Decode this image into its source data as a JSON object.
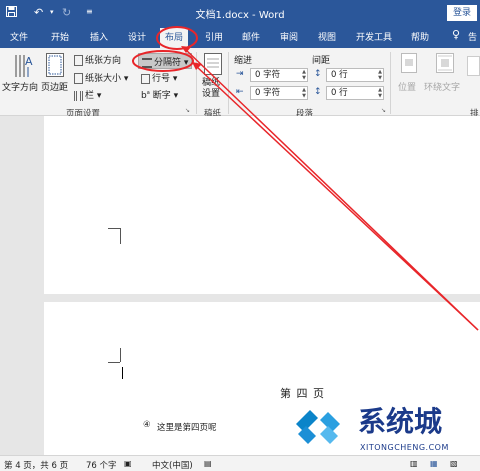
{
  "titlebar": {
    "save_icon": "save-icon",
    "undo_icon": "undo-icon",
    "redo_icon": "redo-icon",
    "qat_more_icon": "qat-more-icon",
    "doc_title": "文档1.docx  -  Word",
    "login": "登录"
  },
  "tabs": [
    "文件",
    "开始",
    "插入",
    "设计",
    "布局",
    "引用",
    "邮件",
    "审阅",
    "视图",
    "开发工具",
    "帮助",
    "告"
  ],
  "tell_me_icon": "lightbulb-icon",
  "ribbon": {
    "text_direction": "文字方向",
    "margins": "页边距",
    "orientation": "纸张方向",
    "size": "纸张大小",
    "columns": "栏",
    "breaks": "分隔符",
    "line_numbers": "行号",
    "hyphenation": "断字",
    "page_setup_group": "页面设置",
    "manuscript": "稿纸设置",
    "manuscript_group": "稿纸",
    "indent_label": "缩进",
    "spacing_label": "间距",
    "indent_left": "0 字符",
    "indent_right": "0 字符",
    "spacing_before": "0 行",
    "spacing_after": "0 行",
    "paragraph_group": "段落",
    "position": "位置",
    "wrap_text": "环绕文字",
    "arrange_group_cut": "排"
  },
  "page4": {
    "title": "第 四 页",
    "line": "这里是第四页呢",
    "marker": "④"
  },
  "watermark": {
    "text": "系统城",
    "url": "XITONGCHENG.COM"
  },
  "statusbar": {
    "page": "第 4 页，共 6 页",
    "words": "76 个字",
    "lang": "中文(中国)"
  },
  "colors": {
    "word_blue": "#2b579a",
    "annotation_red": "#e8262a"
  }
}
